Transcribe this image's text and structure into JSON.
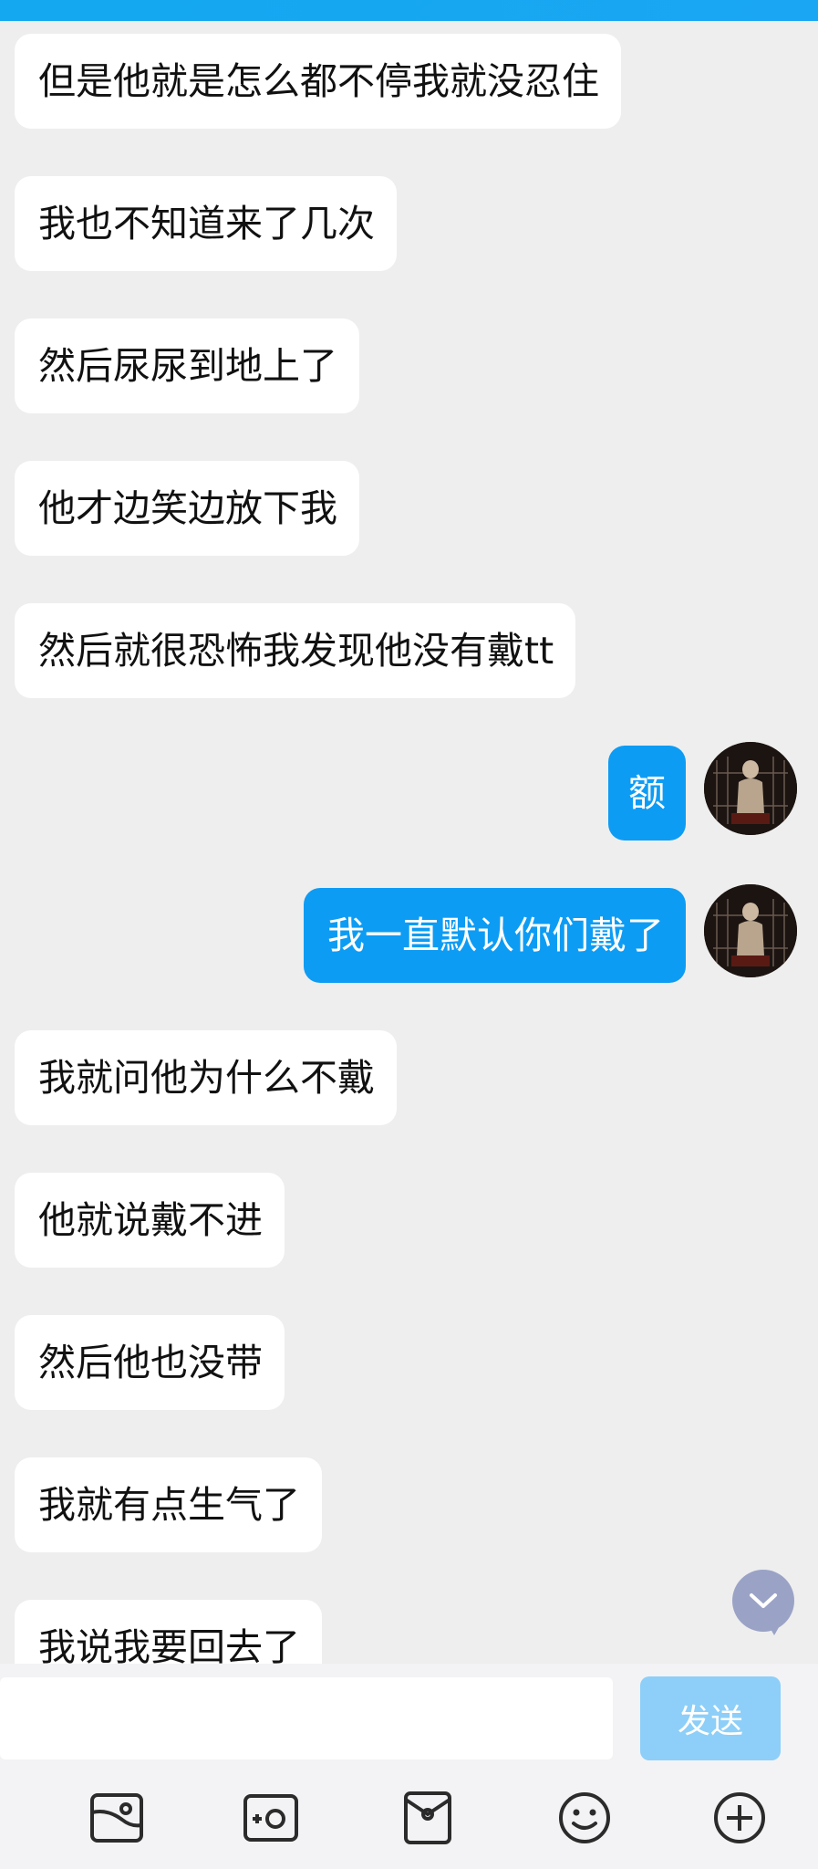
{
  "messages": [
    {
      "side": "in",
      "text": "但是他就是怎么都不停我就没忍住"
    },
    {
      "side": "in",
      "text": "我也不知道来了几次"
    },
    {
      "side": "in",
      "text": "然后尿尿到地上了"
    },
    {
      "side": "in",
      "text": "他才边笑边放下我"
    },
    {
      "side": "in",
      "text": "然后就很恐怖我发现他没有戴tt"
    },
    {
      "side": "out",
      "text": "额"
    },
    {
      "side": "out",
      "text": "我一直默认你们戴了"
    },
    {
      "side": "in",
      "text": "我就问他为什么不戴"
    },
    {
      "side": "in",
      "text": "他就说戴不进"
    },
    {
      "side": "in",
      "text": "然后他也没带"
    },
    {
      "side": "in",
      "text": "我就有点生气了"
    },
    {
      "side": "in",
      "text": "我说我要回去了"
    }
  ],
  "input": {
    "value": "",
    "placeholder": ""
  },
  "send_button": {
    "label": "发送"
  },
  "toolbar": {
    "icons": [
      "image-icon",
      "camera-icon",
      "sticker-icon",
      "emoji-icon",
      "plus-icon"
    ]
  },
  "colors": {
    "accent": "#0d9cf4",
    "background": "#eeeeee",
    "incoming_bubble": "#ffffff",
    "send_disabled": "#8dcff8"
  }
}
